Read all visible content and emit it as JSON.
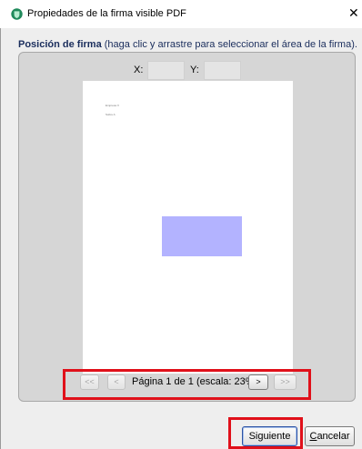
{
  "window": {
    "title": "Propiedades de la firma visible PDF",
    "close_symbol": "✕"
  },
  "section": {
    "label_bold": "Posición de firma",
    "label_rest": " (haga clic y arrastre para seleccionar el área de la firma)."
  },
  "coords": {
    "x_label": "X:",
    "x_value": "",
    "y_label": "Y:",
    "y_value": ""
  },
  "preview": {
    "lines": [
      "Empresa X",
      "Sobre A"
    ]
  },
  "pagination": {
    "first_label": "<<",
    "prev_label": "<",
    "page_text": "Página 1 de 1 (escala: 23%)",
    "next_label": ">",
    "last_label": ">>"
  },
  "buttons": {
    "next_label": "Siguiente",
    "cancel_first": "C",
    "cancel_rest": "ancelar"
  },
  "colors": {
    "highlight": "#e0101a",
    "signature_area": "#b3b3ff",
    "app_icon": "#1f8a5b"
  }
}
